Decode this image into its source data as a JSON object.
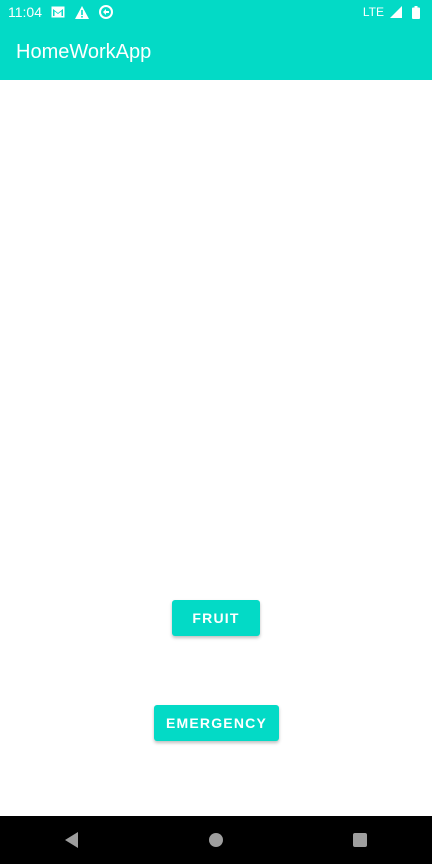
{
  "status_bar": {
    "time": "11:04",
    "network": "LTE",
    "icons": [
      "gmail-icon",
      "warning-icon",
      "sync-icon",
      "signal-icon",
      "battery-icon"
    ]
  },
  "app_bar": {
    "title": "HomeWorkApp"
  },
  "buttons": {
    "fruit_label": "FRUIT",
    "emergency_label": "EMERGENCY"
  },
  "nav_bar": {
    "icons": [
      "back-icon",
      "home-icon",
      "recents-icon"
    ]
  },
  "colors": {
    "accent": "#03dac6",
    "nav_background": "#000000",
    "background": "#ffffff"
  }
}
